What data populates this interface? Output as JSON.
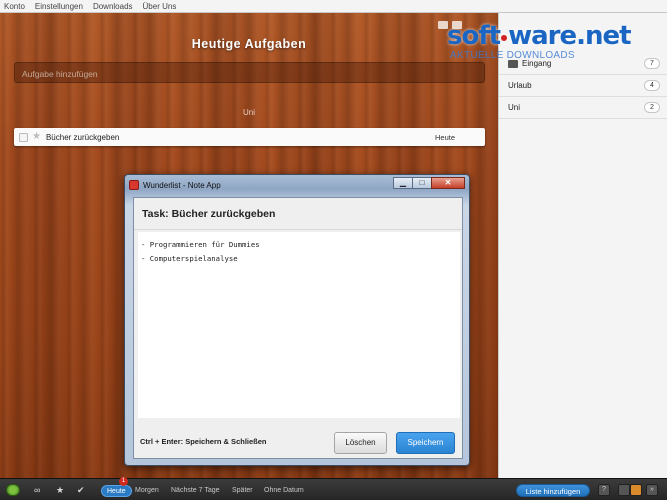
{
  "menu": [
    "Konto",
    "Einstellungen",
    "Downloads",
    "Über Uns"
  ],
  "list": {
    "title": "Heutige Aufgaben",
    "add_placeholder": "Aufgabe hinzufügen",
    "section": "Uni",
    "tasks": [
      {
        "name": "Bücher zurückgeben",
        "date": "Heute"
      }
    ]
  },
  "sidebar": {
    "items": [
      {
        "label": "Eingang",
        "count": "7"
      },
      {
        "label": "Urlaub",
        "count": "4"
      },
      {
        "label": "Uni",
        "count": "2"
      }
    ]
  },
  "watermark": {
    "brand_a": "soft",
    "brand_b": "ware.net",
    "tagline": "AKTUELLE DOWNLOADS"
  },
  "dialog": {
    "title": "Wunderlist - Note App",
    "task_heading": "Task: Bücher zurückgeben",
    "note_lines": [
      "- Programmieren für Dummies",
      "- Computerspielanalyse"
    ],
    "hint": "Ctrl + Enter: Speichern & Schließen",
    "delete_label": "Löschen",
    "save_label": "Speichern",
    "win_minimize": "▁",
    "win_maximize": "□",
    "win_close": "✕"
  },
  "bottombar": {
    "filters": [
      "Heute",
      "Morgen",
      "Nächste 7 Tage",
      "Später",
      "Ohne Datum"
    ],
    "badge": "1",
    "add_list": "Liste hinzufügen",
    "help": "?"
  },
  "colors": {
    "accent_blue": "#2a84d2",
    "wood": "#a64c1f",
    "badge_red": "#d02b1f"
  }
}
